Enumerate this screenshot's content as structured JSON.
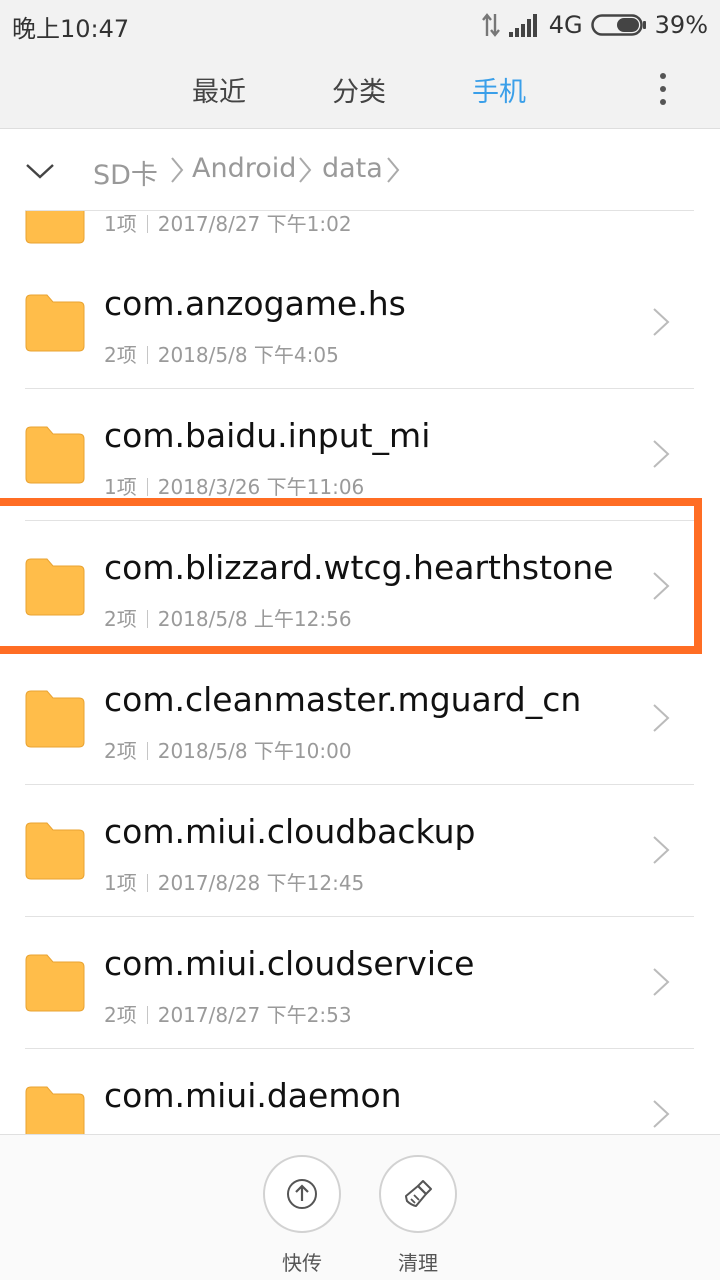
{
  "status_bar": {
    "time": "晚上10:47",
    "network": "4G",
    "battery": "39%"
  },
  "tabs": [
    {
      "label": "最近",
      "active": false
    },
    {
      "label": "分类",
      "active": false
    },
    {
      "label": "手机",
      "active": true
    }
  ],
  "accent_color": "#3a9fe9",
  "highlight_color": "#ff6d24",
  "breadcrumb": [
    "SD卡",
    "Android",
    "data"
  ],
  "folders": [
    {
      "name": "",
      "count": "1项",
      "date": "2017/8/27 下午1:02"
    },
    {
      "name": "com.anzogame.hs",
      "count": "2项",
      "date": "2018/5/8 下午4:05"
    },
    {
      "name": "com.baidu.input_mi",
      "count": "1项",
      "date": "2018/3/26 下午11:06"
    },
    {
      "name": "com.blizzard.wtcg.hearthstone",
      "count": "2项",
      "date": "2018/5/8 上午12:56"
    },
    {
      "name": "com.cleanmaster.mguard_cn",
      "count": "2项",
      "date": "2018/5/8 下午10:00"
    },
    {
      "name": "com.miui.cloudbackup",
      "count": "1项",
      "date": "2017/8/28 下午12:45"
    },
    {
      "name": "com.miui.cloudservice",
      "count": "2项",
      "date": "2017/8/27 下午2:53"
    },
    {
      "name": "com.miui.daemon",
      "count": "",
      "date": ""
    }
  ],
  "bottom_actions": [
    {
      "label": "快传",
      "icon": "share-upload-icon"
    },
    {
      "label": "清理",
      "icon": "broom-icon"
    }
  ]
}
